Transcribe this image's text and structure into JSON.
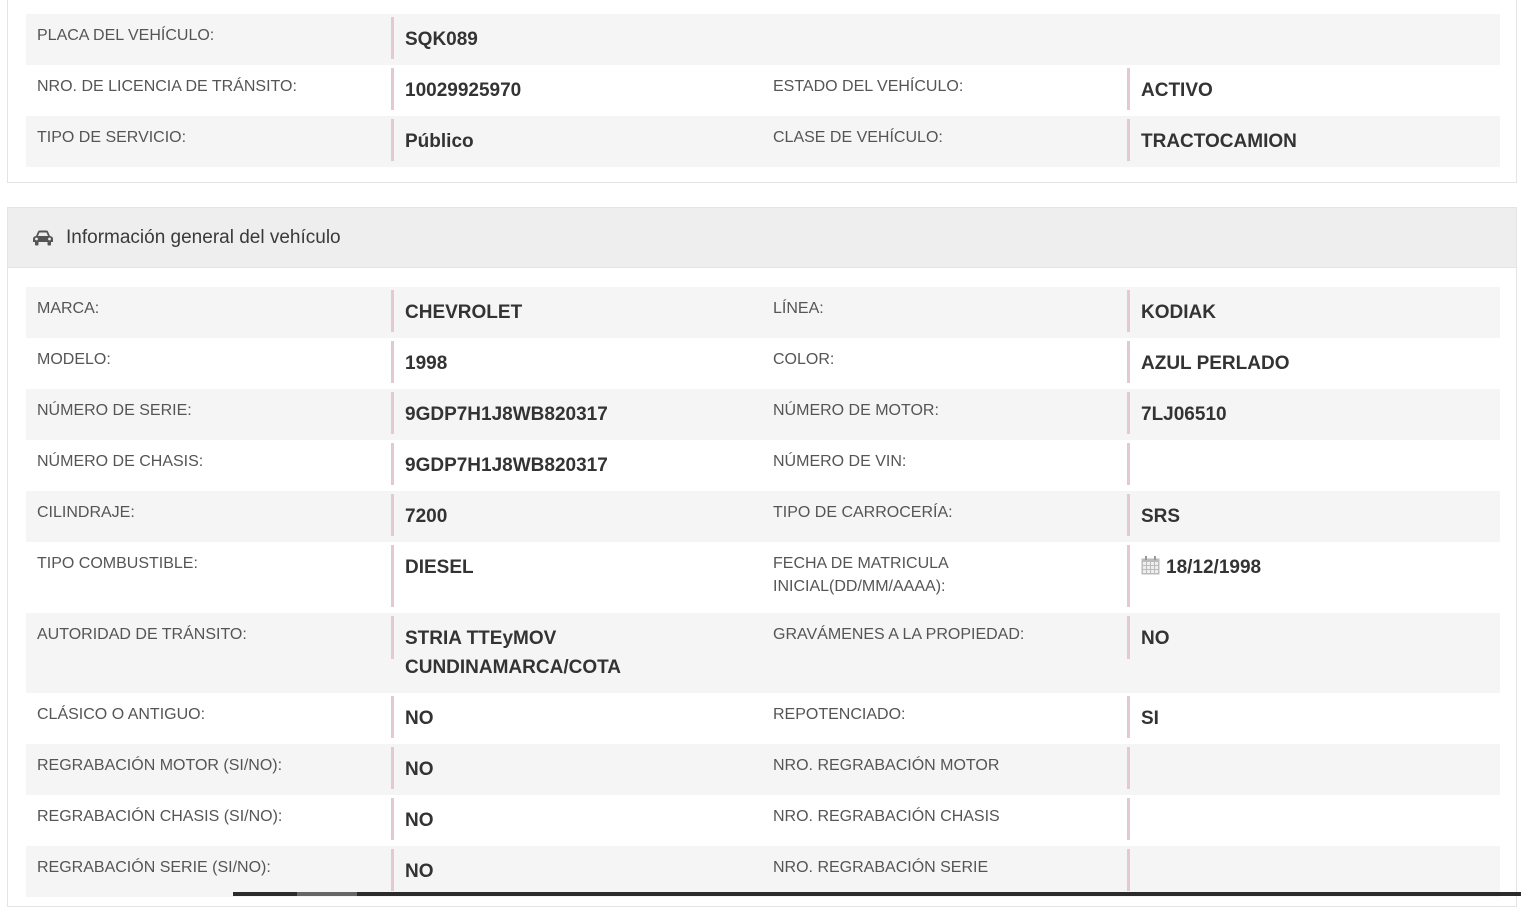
{
  "top_rows": [
    {
      "label1": "PLACA DEL VEHÍCULO:",
      "value1": "SQK089",
      "label2": "",
      "value2": ""
    },
    {
      "label1": "NRO. DE LICENCIA DE TRÁNSITO:",
      "value1": "10029925970",
      "label2": "ESTADO DEL VEHÍCULO:",
      "value2": "ACTIVO"
    },
    {
      "label1": "TIPO DE SERVICIO:",
      "value1": "Público",
      "label2": "CLASE DE VEHÍCULO:",
      "value2": "TRACTOCAMION"
    }
  ],
  "general": {
    "title": "Información general del vehículo",
    "icon": "car-icon",
    "rows": [
      {
        "label1": "MARCA:",
        "value1": "CHEVROLET",
        "label2": "LÍNEA:",
        "value2": "KODIAK"
      },
      {
        "label1": "MODELO:",
        "value1": "1998",
        "label2": "COLOR:",
        "value2": "AZUL PERLADO"
      },
      {
        "label1": "NÚMERO DE SERIE:",
        "value1": "9GDP7H1J8WB820317",
        "label2": "NÚMERO DE MOTOR:",
        "value2": "7LJ06510"
      },
      {
        "label1": "NÚMERO DE CHASIS:",
        "value1": "9GDP7H1J8WB820317",
        "label2": "NÚMERO DE VIN:",
        "value2": ""
      },
      {
        "label1": "CILINDRAJE:",
        "value1": "7200",
        "label2": "TIPO DE CARROCERÍA:",
        "value2": "SRS"
      },
      {
        "label1": "TIPO COMBUSTIBLE:",
        "value1": "DIESEL",
        "label2": "FECHA DE MATRICULA INICIAL(DD/MM/AAAA):",
        "value2": "18/12/1998"
      },
      {
        "label1": "AUTORIDAD DE TRÁNSITO:",
        "value1": "STRIA TTEyMOV CUNDINAMARCA/COTA",
        "label2": "GRAVÁMENES A LA PROPIEDAD:",
        "value2": "NO"
      },
      {
        "label1": "CLÁSICO O ANTIGUO:",
        "value1": "NO",
        "label2": "REPOTENCIADO:",
        "value2": "SI"
      },
      {
        "label1": "REGRABACIÓN MOTOR (SI/NO):",
        "value1": "NO",
        "label2": "NRO. REGRABACIÓN MOTOR",
        "value2": ""
      },
      {
        "label1": "REGRABACIÓN CHASIS (SI/NO):",
        "value1": "NO",
        "label2": "NRO. REGRABACIÓN CHASIS",
        "value2": ""
      },
      {
        "label1": "REGRABACIÓN SERIE (SI/NO):",
        "value1": "NO",
        "label2": "NRO. REGRABACIÓN SERIE",
        "value2": ""
      }
    ]
  },
  "colors": {
    "value_border": "#e6c9d0",
    "stripe": "#f5f5f5",
    "header_bg": "#eeeeee"
  }
}
